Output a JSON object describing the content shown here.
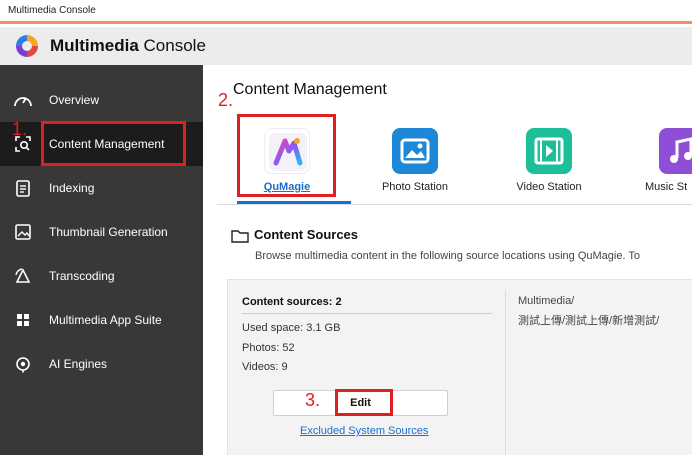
{
  "window": {
    "title": "Multimedia Console"
  },
  "app": {
    "name_bold": "Multimedia",
    "name_rest": " Console"
  },
  "sidebar": {
    "items": [
      {
        "label": "Overview",
        "icon": "gauge-icon"
      },
      {
        "label": "Content Management",
        "icon": "content-search-icon",
        "active": true
      },
      {
        "label": "Indexing",
        "icon": "clipboard-icon"
      },
      {
        "label": "Thumbnail Generation",
        "icon": "image-frame-icon"
      },
      {
        "label": "Transcoding",
        "icon": "transcode-icon"
      },
      {
        "label": "Multimedia App Suite",
        "icon": "app-grid-icon"
      },
      {
        "label": "AI Engines",
        "icon": "ai-chip-icon"
      }
    ]
  },
  "main": {
    "title": "Content Management",
    "tabs": [
      {
        "label": "QuMagie",
        "active": true,
        "icon": "qumagie-icon"
      },
      {
        "label": "Photo Station",
        "icon": "photo-station-icon"
      },
      {
        "label": "Video Station",
        "icon": "video-station-icon"
      },
      {
        "label": "Music St",
        "icon": "music-station-icon"
      }
    ],
    "content_sources": {
      "heading": "Content Sources",
      "description": "Browse multimedia content in the following source locations using QuMagie. To",
      "count_label": "Content sources: 2",
      "used_space": "Used space:  3.1 GB",
      "photos": "Photos:  52",
      "videos": "Videos:  9",
      "paths": [
        "Multimedia/",
        "測試上傳/測試上傳/新增測試/"
      ],
      "edit_label": "Edit",
      "excluded_link": "Excluded System Sources"
    }
  },
  "annotations": {
    "step1": "1.",
    "step2": "2.",
    "step3": "3."
  },
  "colors": {
    "accent": "#1a6fcf",
    "sidebar_bg": "#383838",
    "highlight": "#e02020",
    "titlebar_stripe": "#ef8f6c"
  }
}
